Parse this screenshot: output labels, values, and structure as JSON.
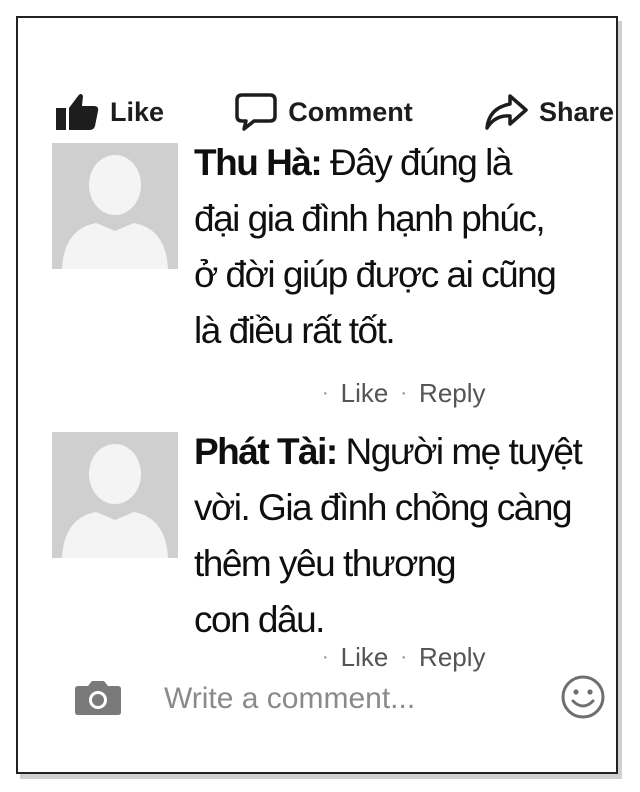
{
  "actions": {
    "like": "Like",
    "comment": "Comment",
    "share": "Share"
  },
  "comments": [
    {
      "author": "Thu Hà:",
      "lines": [
        " Đây đúng là",
        "đại gia đình hạnh phúc,",
        "ở đời giúp được ai cũng",
        "là điều rất tốt."
      ],
      "like": "Like",
      "reply": "Reply"
    },
    {
      "author": "Phát Tài:",
      "lines": [
        " Người mẹ tuyệt",
        "vời. Gia đình chồng càng",
        "thêm yêu thương",
        "con dâu."
      ],
      "like": "Like",
      "reply": "Reply"
    }
  ],
  "composer": {
    "placeholder": "Write a comment..."
  },
  "icons": {
    "like": "thumbs-up-icon",
    "comment": "speech-bubble-icon",
    "share": "share-arrow-icon",
    "avatar": "default-avatar-icon",
    "camera": "camera-icon",
    "emoji": "smiley-icon"
  },
  "colors": {
    "text": "#111111",
    "muted": "#555555",
    "avatar_bg": "#cfcfcf",
    "avatar_fg": "#f4f4f4"
  }
}
